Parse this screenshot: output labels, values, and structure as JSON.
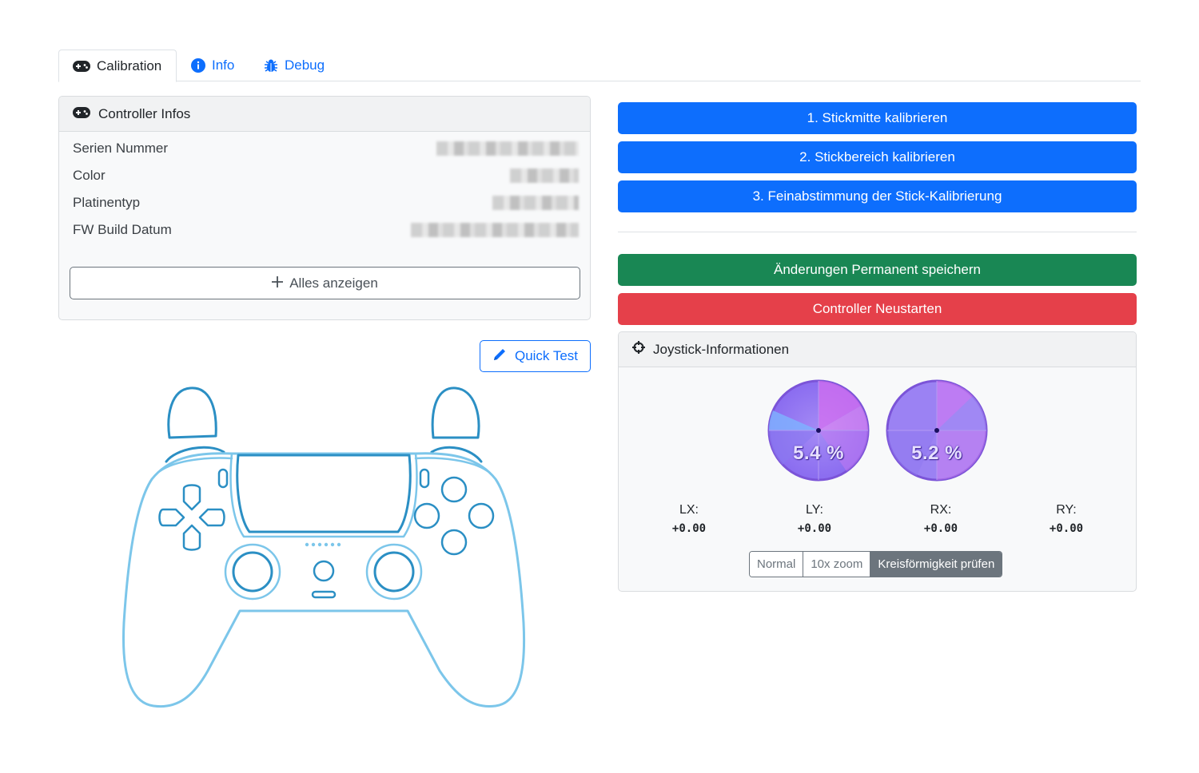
{
  "tabs": [
    {
      "label": "Calibration",
      "icon": "gamepad-icon",
      "active": true
    },
    {
      "label": "Info",
      "icon": "info-circle-icon",
      "active": false
    },
    {
      "label": "Debug",
      "icon": "bug-icon",
      "active": false
    }
  ],
  "controller_info": {
    "title": "Controller Infos",
    "rows": [
      {
        "label": "Serien Nummer"
      },
      {
        "label": "Color"
      },
      {
        "label": "Platinentyp"
      },
      {
        "label": "FW Build Datum"
      }
    ],
    "show_all_label": "Alles anzeigen"
  },
  "quick_test_label": "Quick Test",
  "actions": {
    "calib_center": "1. Stickmitte kalibrieren",
    "calib_range": "2. Stickbereich kalibrieren",
    "calib_fine": "3. Feinabstimmung der Stick-Kalibrierung",
    "save_permanent": "Änderungen Permanent speichern",
    "restart": "Controller Neustarten"
  },
  "joystick": {
    "title": "Joystick-Informationen",
    "left_stick_pct": "5.4 %",
    "right_stick_pct": "5.2 %",
    "axes": [
      {
        "name": "LX:",
        "value": "+0.00"
      },
      {
        "name": "LY:",
        "value": "+0.00"
      },
      {
        "name": "RX:",
        "value": "+0.00"
      },
      {
        "name": "RY:",
        "value": "+0.00"
      }
    ],
    "modes": [
      "Normal",
      "10x zoom",
      "Kreisförmigkeit prüfen"
    ],
    "active_mode": "Kreisförmigkeit prüfen"
  },
  "colors": {
    "primary": "#0d6efd",
    "success": "#198754",
    "danger": "#e5404a",
    "controller_outline": "#6ec1ec",
    "controller_accent": "#2b8fc4"
  }
}
